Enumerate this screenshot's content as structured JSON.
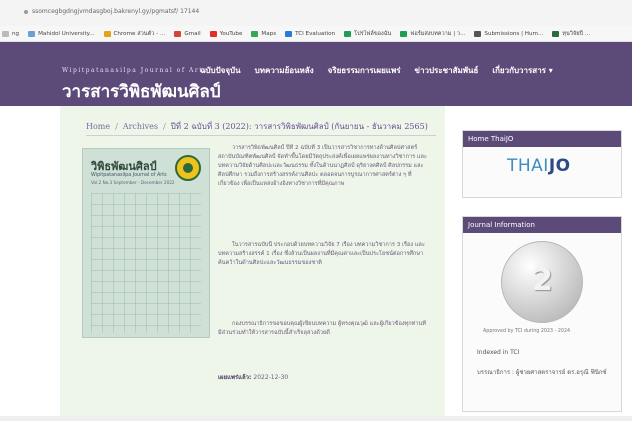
{
  "browser": {
    "url": "ssomcegbgdngjvmdasgboj.bakrenyl.gy/pgmatsf/ 17144"
  },
  "bookmarks": [
    {
      "label": "ng",
      "icon": "page-icon",
      "color": "#bbbbbb"
    },
    {
      "label": "Mahidol University...",
      "icon": "globe-icon",
      "color": "#6aa0d8"
    },
    {
      "label": "Chrome ส่วนตัว - ...",
      "icon": "chrome-icon",
      "color": "#e6a21a"
    },
    {
      "label": "Gmail",
      "icon": "gmail-icon",
      "color": "#d44638"
    },
    {
      "label": "YouTube",
      "icon": "youtube-icon",
      "color": "#e52d27"
    },
    {
      "label": "Maps",
      "icon": "maps-icon",
      "color": "#34a853"
    },
    {
      "label": "TCI Evaluation",
      "icon": "tci-icon",
      "color": "#2a7bd1"
    },
    {
      "label": "โปรไฟล์ของฉัน",
      "icon": "profile-icon",
      "color": "#1f9d55"
    },
    {
      "label": "ฟอร์มส่งบทความ | ว...",
      "icon": "form-icon",
      "color": "#1f9d55"
    },
    {
      "label": "Submissions | Hum...",
      "icon": "ojs-icon",
      "color": "#555555"
    },
    {
      "label": "ทุนวิจัยปี ...",
      "icon": "grant-icon",
      "color": "#2d6a3a"
    }
  ],
  "site": {
    "journal_en": "Wipitpatanasilpa Journal of Arts",
    "journal_th": "วารสารวิพิธพัฒนศิลป์",
    "nav": [
      "ฉบับปัจจุบัน",
      "บทความย้อนหลัง",
      "จริยธรรมการเผยแพร่",
      "ข่าวประชาสัมพันธ์",
      "เกี่ยวกับวารสาร ▾"
    ]
  },
  "breadcrumb": {
    "home": "Home",
    "archives": "Archives",
    "current": "ปีที่ 2 ฉบับที่ 3 (2022): วารสารวิพิธพัฒนศิลป์ (กันยายน - ธันวาคม 2565)"
  },
  "cover": {
    "title": "วิพิธพัฒนศิลป์",
    "subtitle": "Wipitpatanasilpa Journal of Arts",
    "line": "Vol.2 No.3 September - December 2022"
  },
  "description": {
    "p1": "วารสารวิพิธพัฒนศิลป์ ปีที่ 2 ฉบับที่ 3 เป็นวารสารวิชาการทางด้านศิลปศาสตร์ สถาบันบัณฑิตพัฒนศิลป์ จัดทำขึ้นโดยมีวัตถุประสงค์เพื่อเผยแพร่ผลงานทางวิชาการ และบทความวิจัยด้านศิลปะและวัฒนธรรม ทั้งในด้านนาฏศิลป์ ดุริยางคศิลป์ ศิลปกรรม และศิลปศึกษา รวมถึงการสร้างสรรค์งานศิลปะ ตลอดจนการบูรณาการศาสตร์ต่าง ๆ ที่เกี่ยวข้อง เพื่อเป็นแหล่งอ้างอิงทางวิชาการที่มีคุณภาพ",
    "p2": "ในวารสารฉบับนี้ ประกอบด้วยบทความวิจัย 7 เรื่อง บทความวิชาการ 3 เรื่อง และบทความสร้างสรรค์ 1 เรื่อง ซึ่งล้วนเป็นผลงานที่มีคุณค่าและเป็นประโยชน์ต่อการศึกษาค้นคว้าในด้านศิลปะและวัฒนธรรมของชาติ",
    "p3": "กองบรรณาธิการขอขอบคุณผู้เขียนบทความ ผู้ทรงคุณวุฒิ และผู้เกี่ยวข้องทุกท่านที่มีส่วนร่วมทำให้วารสารฉบับนี้สำเร็จลุล่วงด้วยดี",
    "published_label": "เผยแพร่แล้ว:",
    "published_date": "2022-12-30"
  },
  "sidebar": {
    "home_thaijo_title": "Home ThaiJO",
    "thaijo_logo_a": "THAI",
    "thaijo_logo_b": "JO",
    "journal_info_title": "Journal Information",
    "badge_number": "2",
    "approved": "Approved by TCI during 2023 - 2024",
    "indexed": "Indexed in TCI",
    "editor": "บรรณาธิการ : ผู้ช่วยศาสตราจารย์ ดร.อรุณี ฟีนิกซ์"
  },
  "colors": {
    "header": "#5c4a78",
    "main_bg": "#eef6ea",
    "link": "#7a6aa0",
    "thaijo_blue": "#3a8ec2"
  }
}
